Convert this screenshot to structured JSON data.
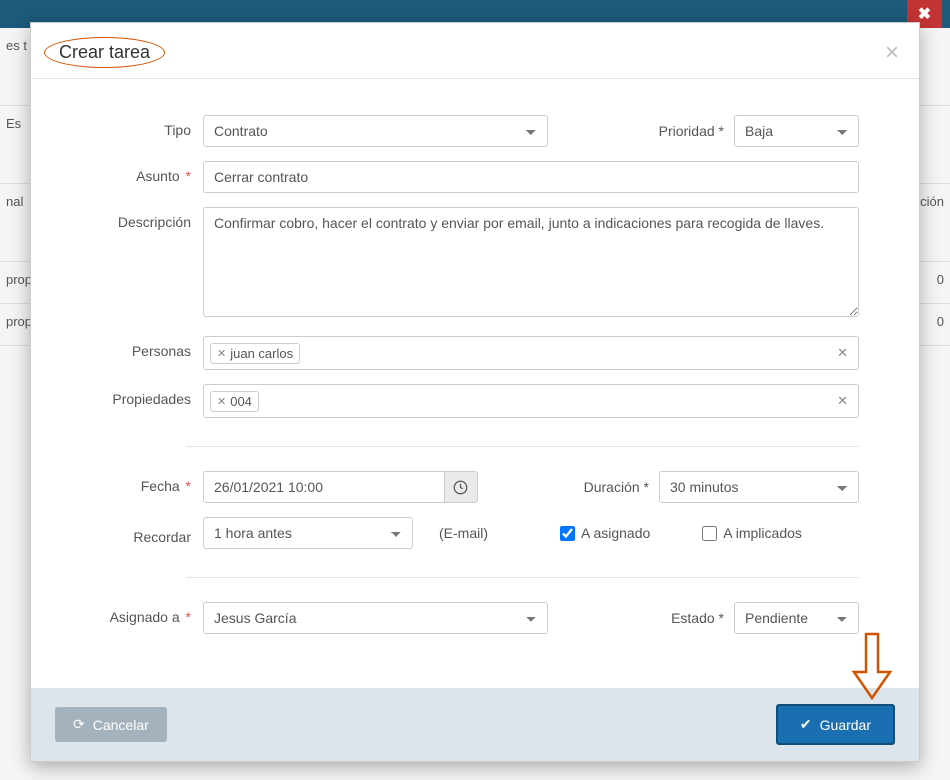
{
  "header": {
    "title": "Crear tarea"
  },
  "background": {
    "row1": "es t",
    "row2": "Es",
    "row3": "nal",
    "row4": "prop",
    "row5": "prop",
    "col_right": "ción",
    "val_right": "0"
  },
  "form": {
    "tipo": {
      "label": "Tipo",
      "value": "Contrato"
    },
    "prioridad": {
      "label": "Prioridad",
      "value": "Baja"
    },
    "asunto": {
      "label": "Asunto",
      "value": "Cerrar contrato"
    },
    "descripcion": {
      "label": "Descripción",
      "value": "Confirmar cobro, hacer el contrato y enviar por email, junto a indicaciones para recogida de llaves."
    },
    "personas": {
      "label": "Personas",
      "tags": [
        "juan carlos"
      ]
    },
    "propiedades": {
      "label": "Propiedades",
      "tags": [
        "004"
      ]
    },
    "fecha": {
      "label": "Fecha",
      "value": "26/01/2021 10:00"
    },
    "duracion": {
      "label": "Duración",
      "value": "30 minutos"
    },
    "recordar": {
      "label": "Recordar",
      "value": "1 hora antes",
      "hint": "(E-mail)"
    },
    "a_asignado": {
      "label": "A asignado",
      "checked": true
    },
    "a_implicados": {
      "label": "A implicados",
      "checked": false
    },
    "asignado_a": {
      "label": "Asignado a",
      "value": "Jesus García"
    },
    "estado": {
      "label": "Estado",
      "value": "Pendiente"
    }
  },
  "footer": {
    "cancel": "Cancelar",
    "save": "Guardar"
  }
}
